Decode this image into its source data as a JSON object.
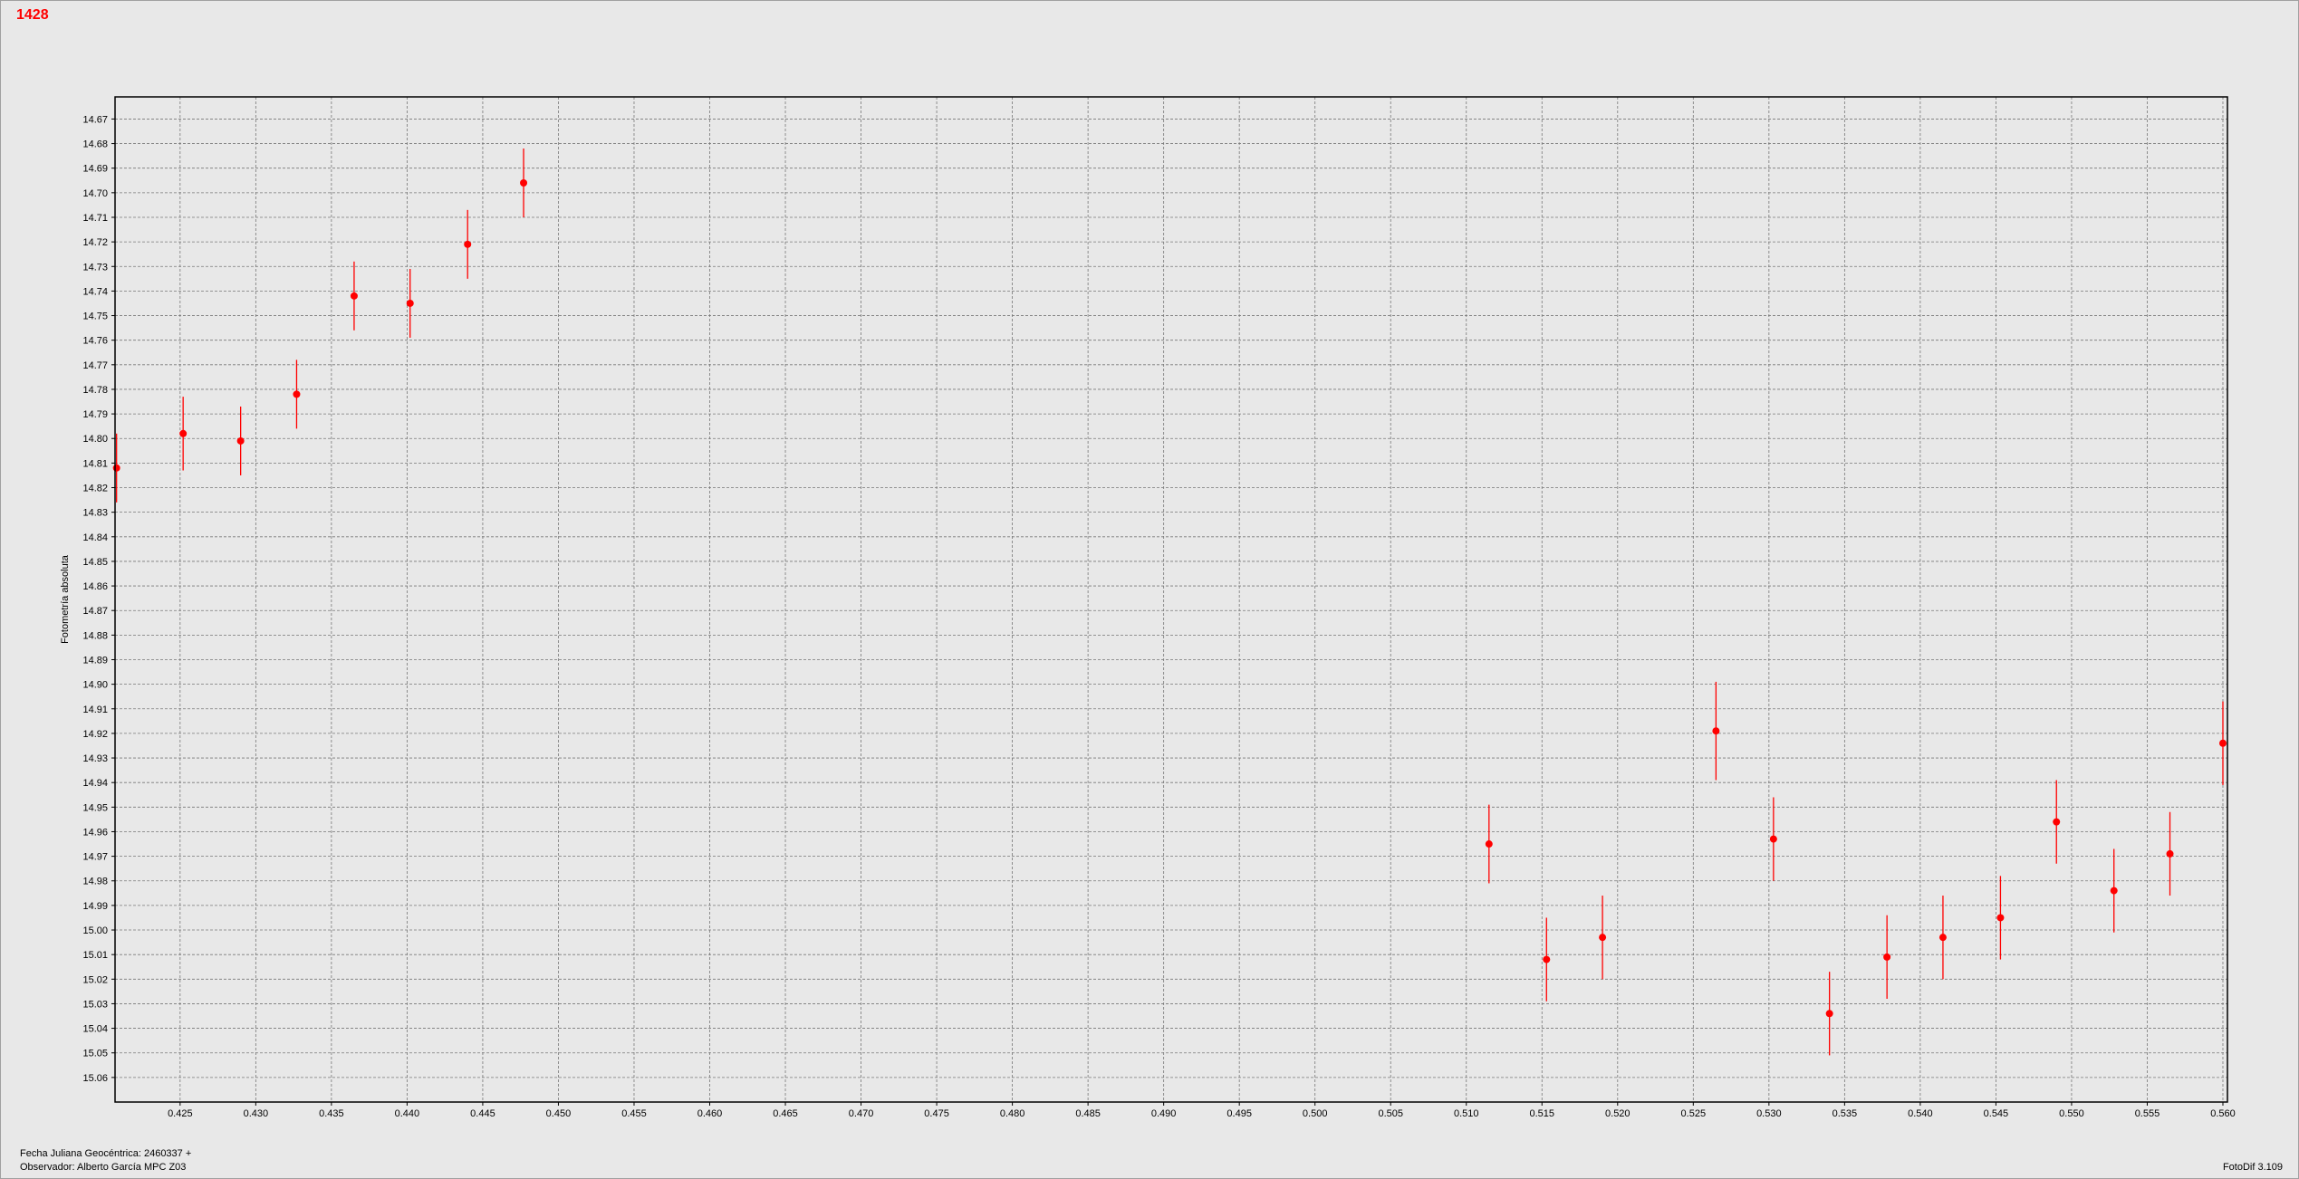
{
  "title": "1428",
  "footer": {
    "date_label": "Fecha Juliana Geocéntrica: 2460337 +",
    "observer_label": "Observador: Alberto García MPC Z03",
    "software_label": "FotoDif 3.109"
  },
  "chart_data": {
    "type": "scatter",
    "title": "1428",
    "xlabel": "",
    "ylabel": "Fotometría absoluta",
    "xlim": [
      0.4207,
      0.5603
    ],
    "ylim": [
      14.661,
      15.07
    ],
    "y_inverted": true,
    "grid": true,
    "legend": "none",
    "color": "#ff0000",
    "x_ticks": [
      "0.425",
      "0.430",
      "0.435",
      "0.440",
      "0.445",
      "0.450",
      "0.455",
      "0.460",
      "0.465",
      "0.470",
      "0.475",
      "0.480",
      "0.485",
      "0.490",
      "0.495",
      "0.500",
      "0.505",
      "0.510",
      "0.515",
      "0.520",
      "0.525",
      "0.530",
      "0.535",
      "0.540",
      "0.545",
      "0.550",
      "0.555",
      "0.560"
    ],
    "y_ticks": [
      "14.67",
      "14.68",
      "14.69",
      "14.70",
      "14.71",
      "14.72",
      "14.73",
      "14.74",
      "14.75",
      "14.76",
      "14.77",
      "14.78",
      "14.79",
      "14.80",
      "14.81",
      "14.82",
      "14.83",
      "14.84",
      "14.85",
      "14.86",
      "14.87",
      "14.88",
      "14.89",
      "14.90",
      "14.91",
      "14.92",
      "14.93",
      "14.94",
      "14.95",
      "14.96",
      "14.97",
      "14.98",
      "14.99",
      "15.00",
      "15.01",
      "15.02",
      "15.03",
      "15.04",
      "15.05",
      "15.06"
    ],
    "points": [
      {
        "x": 0.4208,
        "y": 14.812,
        "err": 0.014
      },
      {
        "x": 0.4252,
        "y": 14.798,
        "err": 0.015
      },
      {
        "x": 0.429,
        "y": 14.801,
        "err": 0.014
      },
      {
        "x": 0.4327,
        "y": 14.782,
        "err": 0.014
      },
      {
        "x": 0.4365,
        "y": 14.742,
        "err": 0.014
      },
      {
        "x": 0.4402,
        "y": 14.745,
        "err": 0.014
      },
      {
        "x": 0.444,
        "y": 14.721,
        "err": 0.014
      },
      {
        "x": 0.4477,
        "y": 14.696,
        "err": 0.014
      },
      {
        "x": 0.5115,
        "y": 14.965,
        "err": 0.016
      },
      {
        "x": 0.5153,
        "y": 15.012,
        "err": 0.017
      },
      {
        "x": 0.519,
        "y": 15.003,
        "err": 0.017
      },
      {
        "x": 0.5265,
        "y": 14.919,
        "err": 0.02
      },
      {
        "x": 0.5303,
        "y": 14.963,
        "err": 0.017
      },
      {
        "x": 0.534,
        "y": 15.034,
        "err": 0.017
      },
      {
        "x": 0.5378,
        "y": 15.011,
        "err": 0.017
      },
      {
        "x": 0.5415,
        "y": 15.003,
        "err": 0.017
      },
      {
        "x": 0.5453,
        "y": 14.995,
        "err": 0.017
      },
      {
        "x": 0.549,
        "y": 14.956,
        "err": 0.017
      },
      {
        "x": 0.5528,
        "y": 14.984,
        "err": 0.017
      },
      {
        "x": 0.5565,
        "y": 14.969,
        "err": 0.017
      },
      {
        "x": 0.56,
        "y": 14.924,
        "err": 0.017
      }
    ]
  }
}
